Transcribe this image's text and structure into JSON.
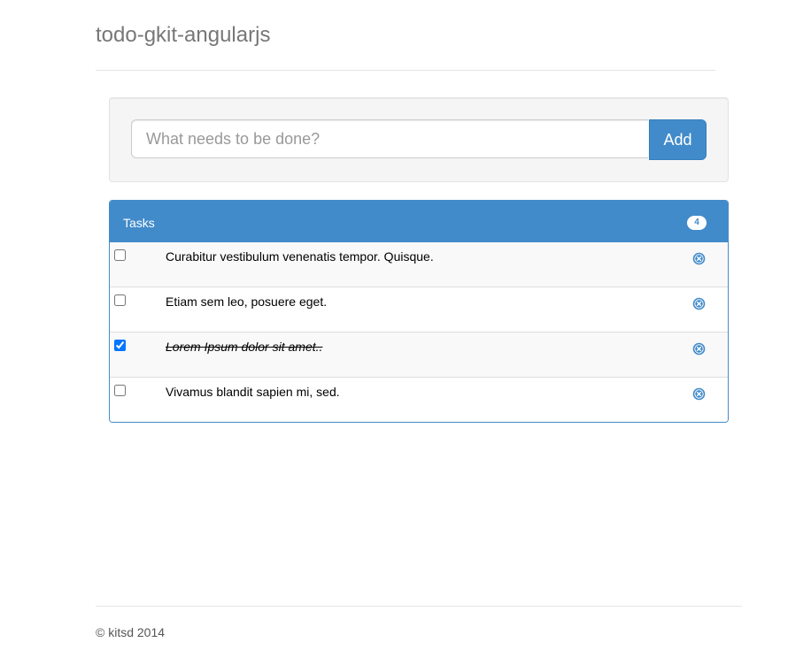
{
  "header": {
    "title": "todo-gkit-angularjs"
  },
  "new_todo": {
    "placeholder": "What needs to be done?",
    "value": "",
    "add_label": "Add"
  },
  "tasks_panel": {
    "title": "Tasks",
    "count": "4",
    "items": [
      {
        "text": "Curabitur vestibulum venenatis tempor. Quisque.",
        "done": false
      },
      {
        "text": "Etiam sem leo, posuere eget.",
        "done": false
      },
      {
        "text": "Lorem Ipsum dolor sit amet..",
        "done": true
      },
      {
        "text": "Vivamus blandit sapien mi, sed.",
        "done": false
      }
    ],
    "remove_icon": "remove-circle-icon"
  },
  "footer": {
    "text": "© kitsd 2014"
  },
  "colors": {
    "primary": "#428bca",
    "title_text": "#777777",
    "row_stripe": "#f9f9f9"
  }
}
